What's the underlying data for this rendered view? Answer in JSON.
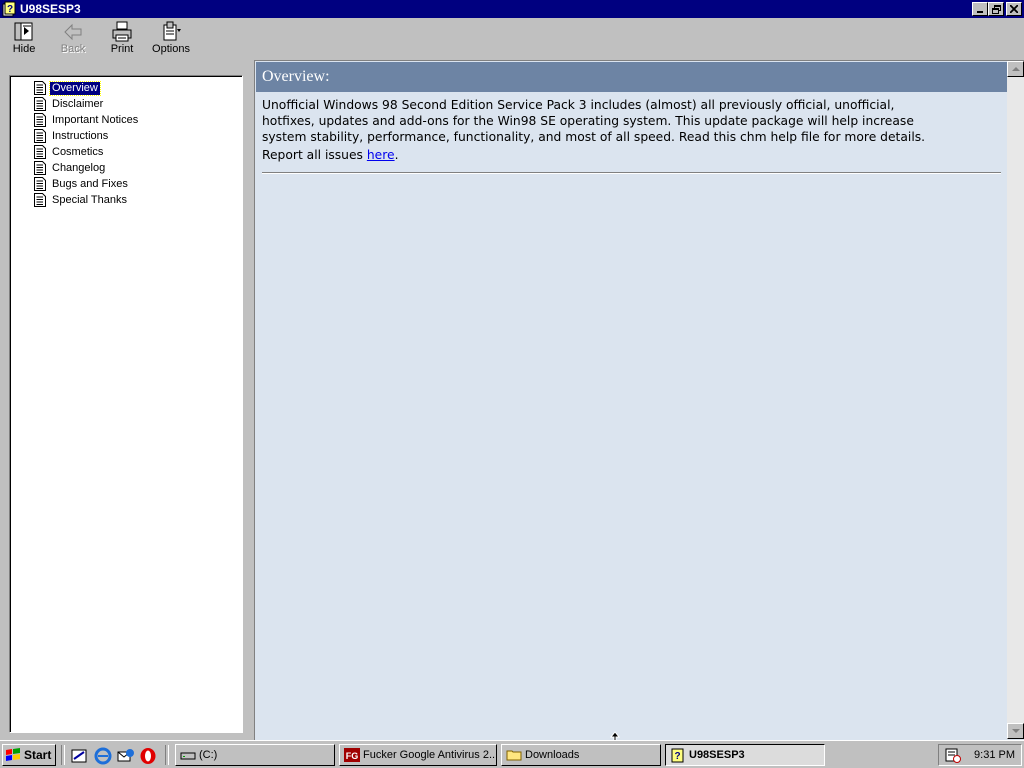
{
  "window": {
    "title": "U98SESP3"
  },
  "toolbar": {
    "hide": "Hide",
    "back": "Back",
    "print": "Print",
    "options": "Options"
  },
  "toc": {
    "items": [
      {
        "label": "Overview",
        "selected": true
      },
      {
        "label": "Disclaimer"
      },
      {
        "label": "Important Notices"
      },
      {
        "label": "Instructions"
      },
      {
        "label": "Cosmetics"
      },
      {
        "label": "Changelog"
      },
      {
        "label": "Bugs and Fixes"
      },
      {
        "label": "Special Thanks"
      }
    ]
  },
  "topic": {
    "heading": "Overview:",
    "line1": "Unofficial Windows 98 Second Edition Service Pack 3 includes (almost) all previously official, unofficial,",
    "line2": "hotfixes, updates and add-ons for the Win98 SE operating system. This update package will help increase",
    "line3": "system stability, performance, functionality, and most of all speed. Read this chm help file for more details.",
    "report_prefix": "Report all issues ",
    "report_link": "here",
    "report_suffix": "."
  },
  "taskbar": {
    "start": "Start",
    "buttons": [
      {
        "label": "(C:)"
      },
      {
        "label": "Fucker Google Antivirus 2..."
      },
      {
        "label": "Downloads"
      },
      {
        "label": "U98SESP3",
        "active": true
      }
    ],
    "clock": "9:31 PM"
  },
  "colors": {
    "title_bar": "#000080",
    "topic_header": "#6d84a4",
    "content_bg": "#dbe4ef",
    "selection": "#000080"
  }
}
